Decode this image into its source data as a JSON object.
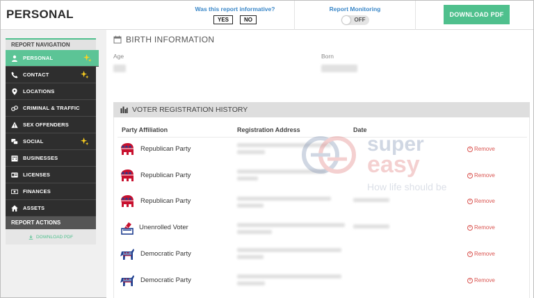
{
  "header": {
    "title": "PERSONAL",
    "feedback_question": "Was this report informative?",
    "yes_label": "YES",
    "no_label": "NO",
    "monitoring_label": "Report Monitoring",
    "toggle_state": "OFF",
    "download_label": "DOWNLOAD PDF"
  },
  "sidebar": {
    "nav_header": "REPORT NAVIGATION",
    "items": [
      {
        "label": "PERSONAL",
        "icon": "person-icon",
        "active": true,
        "new": true
      },
      {
        "label": "CONTACT",
        "icon": "phone-icon",
        "new": true
      },
      {
        "label": "LOCATIONS",
        "icon": "location-pin-icon"
      },
      {
        "label": "CRIMINAL & TRAFFIC",
        "icon": "handcuffs-icon"
      },
      {
        "label": "SEX OFFENDERS",
        "icon": "warning-icon"
      },
      {
        "label": "SOCIAL",
        "icon": "chat-bubbles-icon",
        "new": true
      },
      {
        "label": "BUSINESSES",
        "icon": "building-icon"
      },
      {
        "label": "LICENSES",
        "icon": "license-card-icon"
      },
      {
        "label": "FINANCES",
        "icon": "money-icon"
      },
      {
        "label": "ASSETS",
        "icon": "home-icon"
      }
    ],
    "actions_header": "REPORT ACTIONS",
    "download_label": "DOWNLOAD PDF"
  },
  "birth": {
    "heading": "BIRTH INFORMATION",
    "age_label": "Age",
    "born_label": "Born"
  },
  "voter": {
    "heading": "VOTER REGISTRATION HISTORY",
    "columns": [
      "Party Affiliation",
      "Registration Address",
      "Date"
    ],
    "remove_label": "Remove",
    "rows": [
      {
        "party": "Republican Party",
        "icon": "republican-elephant-icon"
      },
      {
        "party": "Republican Party",
        "icon": "republican-elephant-icon"
      },
      {
        "party": "Republican Party",
        "icon": "republican-elephant-icon"
      },
      {
        "party": "Unenrolled Voter",
        "icon": "ballot-box-icon"
      },
      {
        "party": "Democratic Party",
        "icon": "democratic-donkey-icon"
      },
      {
        "party": "Democratic Party",
        "icon": "democratic-donkey-icon"
      }
    ]
  },
  "watermark": {
    "line1": "super",
    "line2": "easy",
    "tagline": "How life should be"
  },
  "colors": {
    "accent": "#4fc08d",
    "link": "#3a87c8",
    "remove": "#d9534f",
    "republican": "#c8102e",
    "democrat": "#1f3f8f"
  }
}
